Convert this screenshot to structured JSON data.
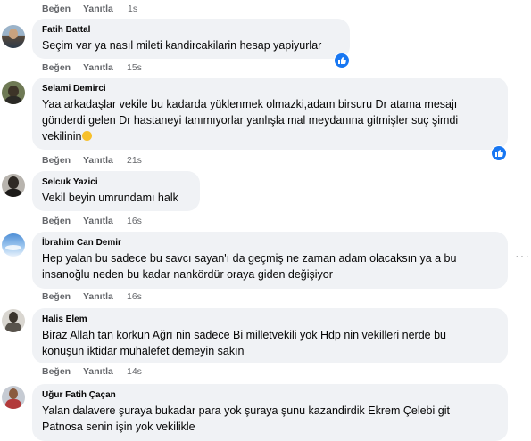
{
  "ui": {
    "like": "Beğen",
    "reply": "Yanıtla",
    "more": "···"
  },
  "comments": [
    {
      "time": "1s"
    },
    {
      "author": "Fatih Battal",
      "lines": [
        "Seçim var ya nasıl mileti kandircakilarin hesap yapiyurlar"
      ],
      "time": "15s",
      "liked": true
    },
    {
      "author": "Selami Demirci",
      "lines": [
        "Yaa arkadaşlar vekile bu kadarda yüklenmek olmazki,adam birsuru Dr atama mesajı",
        "gönderdi gelen Dr hastaneyi tanımıyorlar yanlışla mal meydanına gitmişler suç şimdi",
        "vekilinin"
      ],
      "emoji": "smiling-face",
      "time": "21s",
      "liked": true
    },
    {
      "author": "Selcuk Yazici",
      "lines": [
        "Vekil beyin umrundamı halk"
      ],
      "time": "16s"
    },
    {
      "author": "İbrahim Can Demir",
      "lines": [
        "Hep yalan bu sadece bu savcı sayan'ı da geçmiş ne zaman adam olacaksın ya a bu",
        "insanoğlu neden bu kadar nankördür oraya giden değişiyor"
      ],
      "time": "16s",
      "more": true
    },
    {
      "author": "Halis Elem",
      "lines": [
        "Biraz Allah tan korkun Ağrı nin sadece Bi milletvekili yok Hdp nin vekilleri nerde bu",
        "konuşun iktidar muhalefet demeyin sakın"
      ],
      "time": "14s"
    },
    {
      "author": "Uğur Fatih Çaçan",
      "lines": [
        "Yalan dalavere şuraya bukadar para yok şuraya şunu kazandirdik Ekrem Çelebi git",
        "Patnosa senin işin yok vekilikle"
      ]
    }
  ]
}
